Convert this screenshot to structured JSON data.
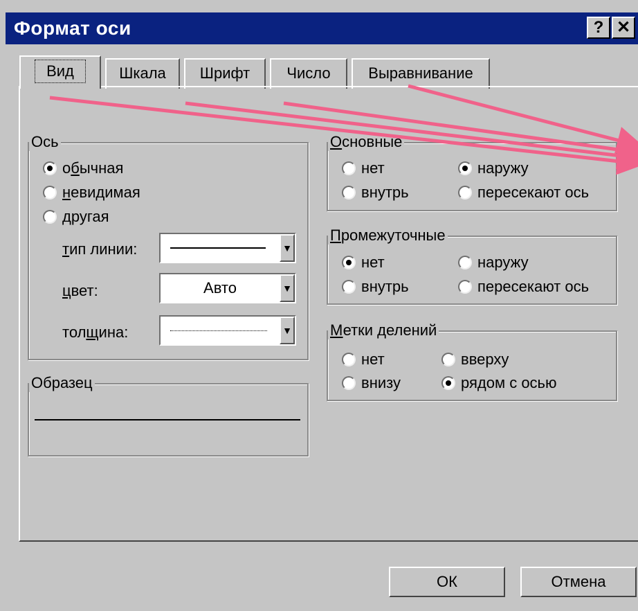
{
  "window": {
    "title": "Формат оси",
    "help_label": "?",
    "close_label": "✕"
  },
  "tabs": [
    {
      "label": "Вид",
      "active": true
    },
    {
      "label": "Шкала"
    },
    {
      "label": "Шрифт"
    },
    {
      "label": "Число"
    },
    {
      "label": "Выравнивание"
    }
  ],
  "axis_group": {
    "legend": "Ось",
    "options": [
      {
        "pre": "о",
        "u": "б",
        "post": "ычная",
        "selected": true
      },
      {
        "pre": "",
        "u": "н",
        "post": "евидимая",
        "selected": false
      },
      {
        "pre": "",
        "u": "",
        "post": "другая",
        "selected": false
      }
    ],
    "line_type": {
      "pre": "",
      "u": "т",
      "post": "ип линии:"
    },
    "color": {
      "pre": "",
      "u": "ц",
      "post": "вет:",
      "value": "Авто"
    },
    "weight": {
      "pre": "тол",
      "u": "щ",
      "post": "ина:"
    }
  },
  "sample_group": {
    "legend": "Образец"
  },
  "major_group": {
    "legend_u": "О",
    "legend_rest": "сновные",
    "options": [
      {
        "label": "нет",
        "selected": false
      },
      {
        "label": "наружу",
        "selected": true
      },
      {
        "label": "внутрь",
        "selected": false
      },
      {
        "label": "пересекают ось",
        "selected": false
      }
    ]
  },
  "minor_group": {
    "legend_u": "П",
    "legend_rest": "ромежуточные",
    "options": [
      {
        "label": "нет",
        "selected": true
      },
      {
        "label": "наружу",
        "selected": false
      },
      {
        "label": "внутрь",
        "selected": false
      },
      {
        "label": "пересекают ось",
        "selected": false
      }
    ]
  },
  "tick_labels_group": {
    "legend_u": "М",
    "legend_rest": "етки делений",
    "options": [
      {
        "label": "нет",
        "selected": false
      },
      {
        "label": "вверху",
        "selected": false
      },
      {
        "label": "внизу",
        "selected": false
      },
      {
        "label": "рядом с осью",
        "selected": true
      }
    ]
  },
  "buttons": {
    "ok": "ОК",
    "cancel": "Отмена"
  },
  "colors": {
    "title_bar": "#0a2280",
    "dialog_bg": "#c5c5c5",
    "arrows": "#f0628a"
  }
}
